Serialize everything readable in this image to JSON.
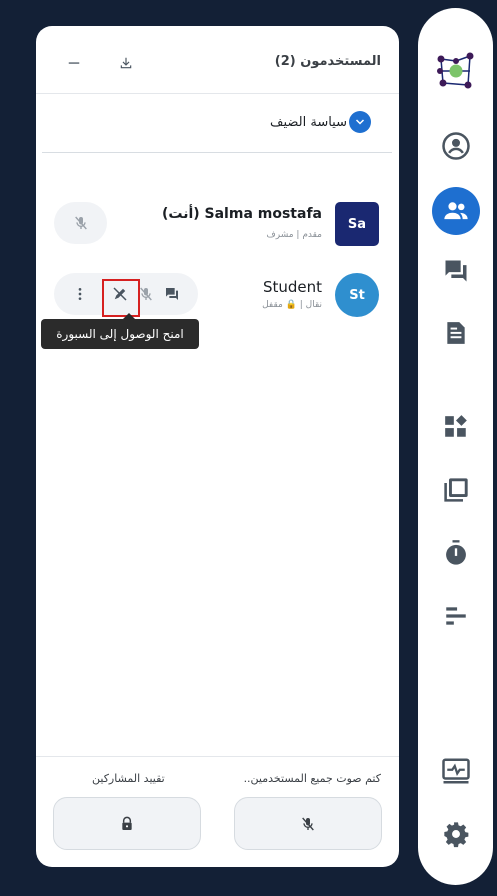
{
  "panel": {
    "title": "المستخدمون (2)",
    "guest_policy_label": "سياسة الضيف",
    "users": [
      {
        "initials": "Sa",
        "name": "Salma mostafa (أنت)",
        "role": "مقدم | مشرف",
        "avatar_color": "#1a2871"
      },
      {
        "initials": "St",
        "name": "Student",
        "role": "نقال | 🔒 مقفل",
        "avatar_color": "#2f8fcf"
      }
    ],
    "tooltip": "امنح الوصول إلى السبورة",
    "footer": {
      "mute_all_label": "كتم صوت جميع المستخدمين..",
      "lock_viewers_label": "تقييد المشاركين"
    }
  },
  "colors": {
    "accent": "#1e6fd0",
    "background": "#132036",
    "highlight": "#d62020"
  },
  "nav_rail": [
    "logo-icon",
    "account-icon",
    "users-icon",
    "chat-icon",
    "notes-icon",
    "apps-icon",
    "layers-icon",
    "timer-icon",
    "poll-icon",
    "activity-icon",
    "settings-icon"
  ]
}
